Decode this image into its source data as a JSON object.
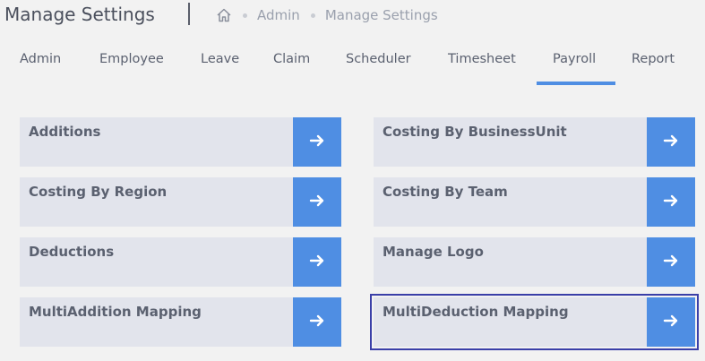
{
  "header": {
    "title": "Manage Settings",
    "breadcrumb": [
      "Admin",
      "Manage Settings"
    ]
  },
  "tabs": [
    {
      "label": "Admin"
    },
    {
      "label": "Employee"
    },
    {
      "label": "Leave"
    },
    {
      "label": "Claim"
    },
    {
      "label": "Scheduler"
    },
    {
      "label": "Timesheet"
    },
    {
      "label": "Payroll",
      "active": true
    },
    {
      "label": "Report"
    }
  ],
  "cards": [
    {
      "label": "Additions"
    },
    {
      "label": "Costing By BusinessUnit"
    },
    {
      "label": "Costing By Region"
    },
    {
      "label": "Costing By Team"
    },
    {
      "label": "Deductions"
    },
    {
      "label": "Manage Logo"
    },
    {
      "label": "MultiAddition Mapping"
    },
    {
      "label": "MultiDeduction Mapping",
      "selected": true
    }
  ],
  "colors": {
    "accent": "#4f8ee3",
    "card_bg": "#e2e4ec",
    "selected_outline": "#3a3fa8"
  }
}
